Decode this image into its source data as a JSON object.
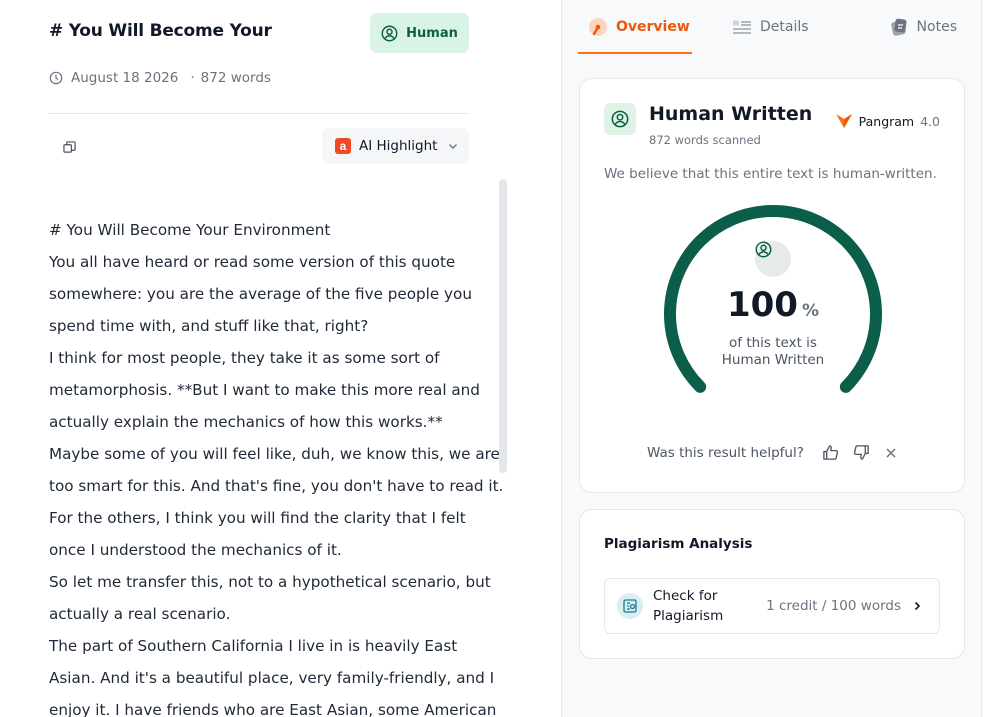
{
  "document": {
    "title": "# You Will Become Your",
    "badge_label": "Human",
    "date": "August 18 2026",
    "word_count": "872 words",
    "highlight_select": "AI Highlight",
    "lines": [
      "# You Will Become Your Environment",
      "You all have heard or read some version of this quote",
      "somewhere: you are the average of the five people you",
      "spend time with, and stuff like that, right?",
      "I think for most people, they take it as some sort of",
      "metamorphosis. **But I want to make this more real and",
      "actually explain the mechanics of how this works.**",
      "Maybe some of you will feel like, duh, we know this, we are",
      "too smart for this. And that's fine, you don't have to read it.",
      "For the others, I think you will find the clarity that I felt",
      "once I understood the mechanics of it.",
      "So let me transfer this, not to a hypothetical scenario, but",
      "actually a real scenario.",
      "The part of Southern California I live in is heavily East",
      "Asian. And it's a beautiful place, very family-friendly, and I",
      "enjoy it. I have friends who are East Asian, some American"
    ]
  },
  "sidebar": {
    "tabs": [
      {
        "label": "Overview",
        "icon": "gauge-icon",
        "active": true
      },
      {
        "label": "Details",
        "icon": "list-icon",
        "active": false
      },
      {
        "label": "Notes",
        "icon": "notes-icon",
        "active": false
      }
    ],
    "result": {
      "title": "Human Written",
      "words_scanned": "872 words scanned",
      "model_name": "Pangram",
      "model_version": "4.0",
      "description": "We believe that this entire text is human-written.",
      "score": "100",
      "score_unit": "%",
      "score_fraction": 1.0,
      "caption_line1": "of this text is",
      "caption_line2": "Human Written",
      "feedback_question": "Was this result helpful?"
    },
    "plagiarism": {
      "title": "Plagiarism Analysis",
      "button_label": "Check for Plagiarism",
      "credit_text": "1 credit / 100 words"
    }
  },
  "colors": {
    "accent": "#f97316",
    "human_green": "#0f5e45",
    "gauge_green": "#0b5e4a",
    "badge_bg": "#d9f3e4"
  }
}
